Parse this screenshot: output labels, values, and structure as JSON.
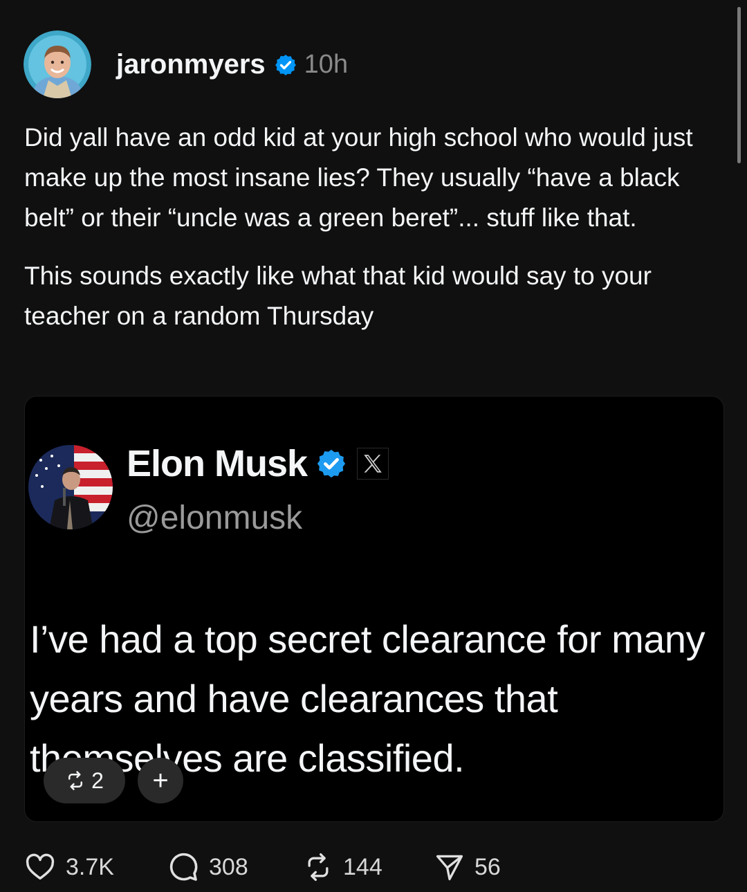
{
  "post": {
    "author": "jaronmyers",
    "time": "10h",
    "paragraphs": [
      "Did yall have an odd kid at your high school who would just make up the most insane lies? They usually “have a black belt” or their “uncle was a green beret”... stuff like that.",
      "This sounds exactly like what that kid would say to your teacher on a random Thursday"
    ]
  },
  "quote": {
    "name": "Elon Musk",
    "handle": "@elonmusk",
    "text": "I’ve had a top secret clearance for many years and have clearances that themselves are classified.",
    "repost_count": "2",
    "plus_label": "+"
  },
  "actions": {
    "likes": "3.7K",
    "replies": "308",
    "reposts": "144",
    "shares": "56"
  },
  "colors": {
    "background": "#101010",
    "verified": "#0095f6",
    "text": "#f3f5f7",
    "muted": "#8a8a8a"
  }
}
